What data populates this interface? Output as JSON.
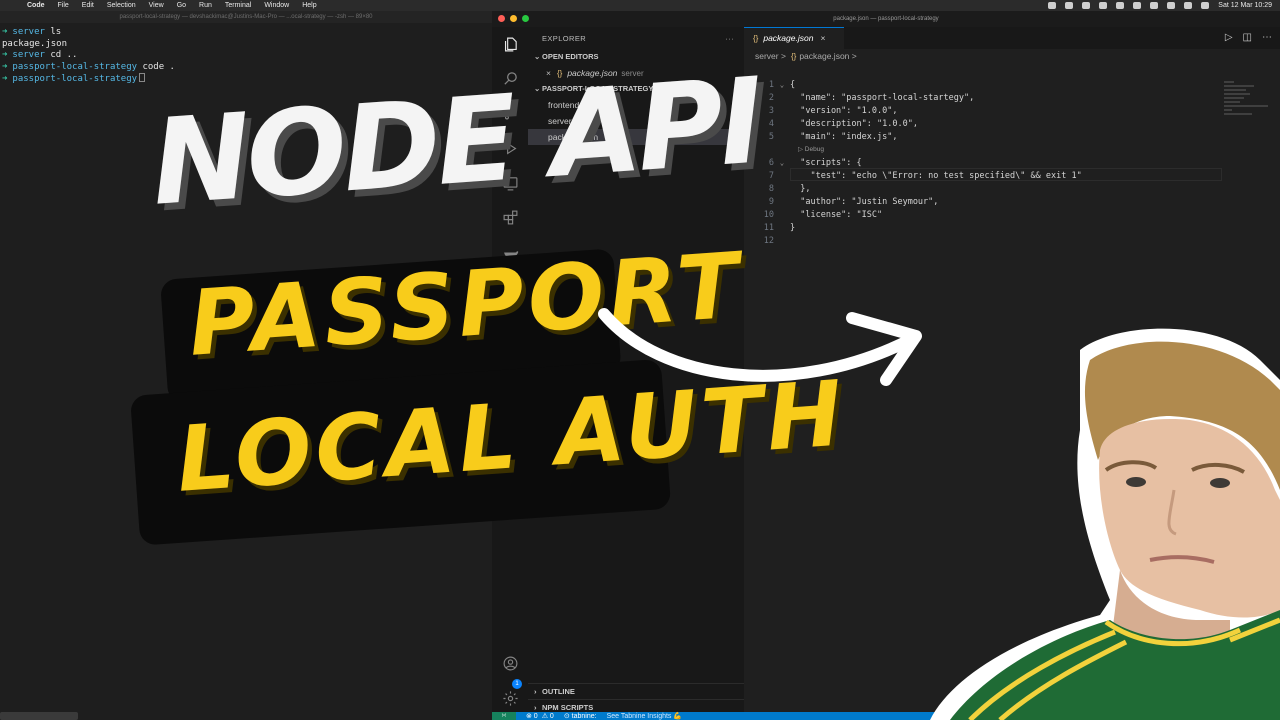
{
  "menubar": {
    "app": "Code",
    "items": [
      "File",
      "Edit",
      "Selection",
      "View",
      "Go",
      "Run",
      "Terminal",
      "Window",
      "Help"
    ],
    "clock": "Sat 12 Mar  10:29"
  },
  "terminal": {
    "title": "passport-local-strategy — devshackimac@Justins-Mac-Pro — ...ocal-strategy — -zsh — 89×80",
    "lines": [
      {
        "arrow": "➜",
        "dir": "server",
        "cmd": " ls"
      },
      {
        "arrow": "",
        "dir": "",
        "cmd": "package.json"
      },
      {
        "arrow": "➜",
        "dir": "server",
        "cmd": " cd .."
      },
      {
        "arrow": "➜",
        "dir": "passport-local-strategy",
        "cmd": " code ."
      },
      {
        "arrow": "➜",
        "dir": "passport-local-strategy",
        "cmd": ""
      }
    ]
  },
  "vscode": {
    "window_title": "package.json — passport-local-strategy",
    "explorer_label": "EXPLORER",
    "explorer_more": "···",
    "open_editors_label": "OPEN EDITORS",
    "open_editor": {
      "close": "×",
      "file": "package.json",
      "folder": "server"
    },
    "project_label": "PASSPORT-LOCAL-STRATEGY",
    "tree": [
      "frontend",
      "server",
      "package.json"
    ],
    "outline_label": "OUTLINE",
    "npm_label": "NPM SCRIPTS",
    "account_badge": "1",
    "tab": {
      "file": "package.json",
      "close": "×"
    },
    "breadcrumb": {
      "folder": "server",
      "sep": ">",
      "file": "package.json",
      "tail": ">"
    },
    "codelens": "▷ Debug",
    "code_lines": [
      {
        "n": "1",
        "fold": "⌄",
        "text": "{"
      },
      {
        "n": "2",
        "fold": "",
        "text": "  \"name\": \"passport-local-startegy\","
      },
      {
        "n": "3",
        "fold": "",
        "text": "  \"version\": \"1.0.0\","
      },
      {
        "n": "4",
        "fold": "",
        "text": "  \"description\": \"1.0.0\","
      },
      {
        "n": "5",
        "fold": "",
        "text": "  \"main\": \"index.js\","
      },
      {
        "n": "6",
        "fold": "⌄",
        "text": "  \"scripts\": {"
      },
      {
        "n": "7",
        "fold": "",
        "text": "    \"test\": \"echo \\\"Error: no test specified\\\" && exit 1\""
      },
      {
        "n": "8",
        "fold": "",
        "text": "  },"
      },
      {
        "n": "9",
        "fold": "",
        "text": "  \"author\": \"Justin Seymour\","
      },
      {
        "n": "10",
        "fold": "",
        "text": "  \"license\": \"ISC\""
      },
      {
        "n": "11",
        "fold": "",
        "text": "}"
      },
      {
        "n": "12",
        "fold": "",
        "text": ""
      }
    ],
    "status": {
      "errors": "⊗ 0",
      "warnings": "⚠ 0",
      "tabnine": "⊙ tabnine:",
      "insights": "See Tabnine Insights 💪"
    }
  },
  "overlay": {
    "headline": "NODE API",
    "line1": "PASSPORT",
    "line2": "LOCAL AUTH"
  },
  "colors": {
    "headline": "#f4f4f4",
    "accent_yellow": "#f8cc1b",
    "status_blue": "#007acc",
    "jersey_green": "#1f6b35"
  }
}
